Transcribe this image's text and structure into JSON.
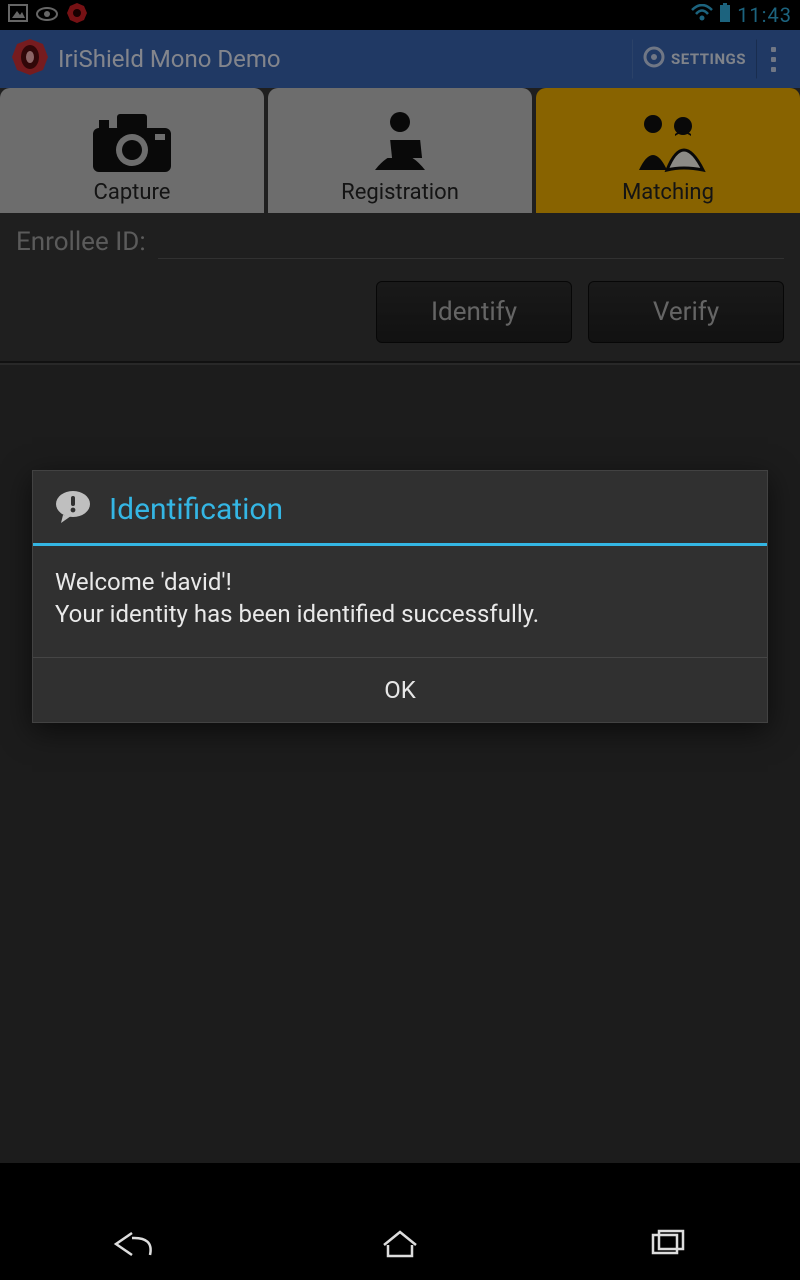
{
  "status": {
    "time": "11:43"
  },
  "header": {
    "title": "IriShield Mono Demo",
    "settings_label": "SETTINGS"
  },
  "tabs": {
    "capture": "Capture",
    "registration": "Registration",
    "matching": "Matching"
  },
  "form": {
    "field_label": "Enrollee ID:",
    "identify_label": "Identify",
    "verify_label": "Verify",
    "enrollee_value": ""
  },
  "dialog": {
    "title": "Identification",
    "body": "Welcome 'david'!\nYour identity has been identified successfully.",
    "ok_label": "OK"
  }
}
